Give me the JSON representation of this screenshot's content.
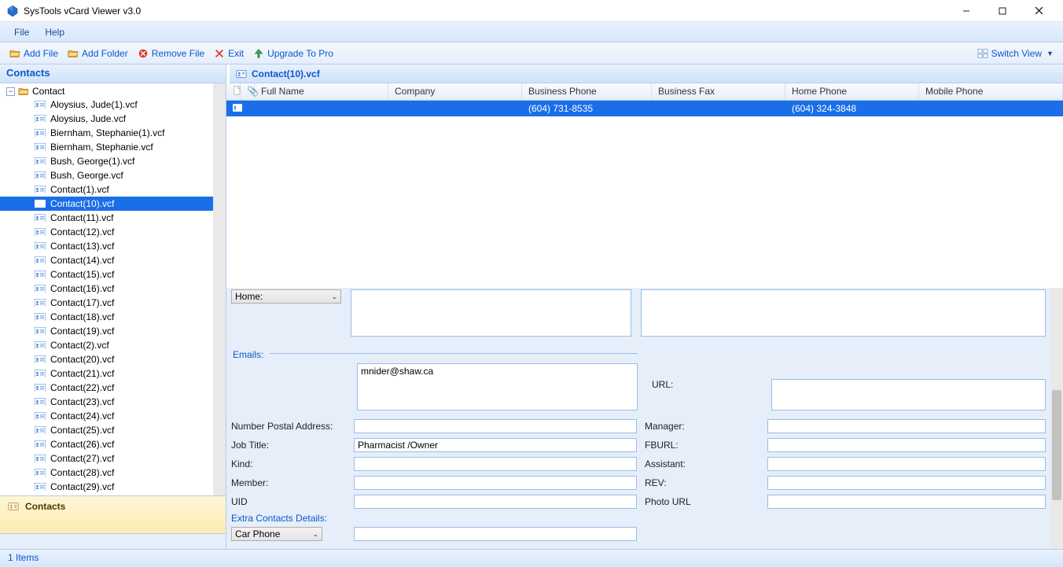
{
  "app": {
    "title": "SysTools vCard Viewer v3.0"
  },
  "menubar": {
    "file": "File",
    "help": "Help"
  },
  "toolbar": {
    "add_file": "Add File",
    "add_folder": "Add Folder",
    "remove_file": "Remove File",
    "exit": "Exit",
    "upgrade": "Upgrade To Pro",
    "switch_view": "Switch View"
  },
  "sidebar": {
    "header": "Contacts",
    "root": "Contact",
    "items": [
      "Aloysius, Jude(1).vcf",
      "Aloysius, Jude.vcf",
      "Biernham, Stephanie(1).vcf",
      "Biernham, Stephanie.vcf",
      "Bush, George(1).vcf",
      "Bush, George.vcf",
      "Contact(1).vcf",
      "Contact(10).vcf",
      "Contact(11).vcf",
      "Contact(12).vcf",
      "Contact(13).vcf",
      "Contact(14).vcf",
      "Contact(15).vcf",
      "Contact(16).vcf",
      "Contact(17).vcf",
      "Contact(18).vcf",
      "Contact(19).vcf",
      "Contact(2).vcf",
      "Contact(20).vcf",
      "Contact(21).vcf",
      "Contact(22).vcf",
      "Contact(23).vcf",
      "Contact(24).vcf",
      "Contact(25).vcf",
      "Contact(26).vcf",
      "Contact(27).vcf",
      "Contact(28).vcf",
      "Contact(29).vcf"
    ],
    "selected_index": 7,
    "bottom_label": "Contacts"
  },
  "content": {
    "title": "Contact(10).vcf",
    "columns": {
      "full_name": "Full Name",
      "company": "Company",
      "business_phone": "Business Phone",
      "business_fax": "Business Fax",
      "home_phone": "Home Phone",
      "mobile_phone": "Mobile Phone"
    },
    "rows": [
      {
        "full_name": "",
        "company": "",
        "business_phone": "(604) 731-8535",
        "business_fax": "",
        "home_phone": "(604) 324-3848",
        "mobile_phone": ""
      }
    ]
  },
  "details": {
    "home_dd": "Home:",
    "emails_label": "Emails:",
    "email_value": "mnider@shaw.ca",
    "url_label": "URL:",
    "number_postal": "Number Postal Address:",
    "manager": "Manager:",
    "job_title_label": "Job Title:",
    "job_title_value": "Pharmacist /Owner",
    "fburl": "FBURL:",
    "kind": "Kind:",
    "assistant": "Assistant:",
    "member": "Member:",
    "rev": "REV:",
    "uid": "UID",
    "photo_url": "Photo URL",
    "extra_label": "Extra Contacts Details:",
    "car_phone": "Car Phone"
  },
  "statusbar": {
    "items": "1 Items"
  }
}
